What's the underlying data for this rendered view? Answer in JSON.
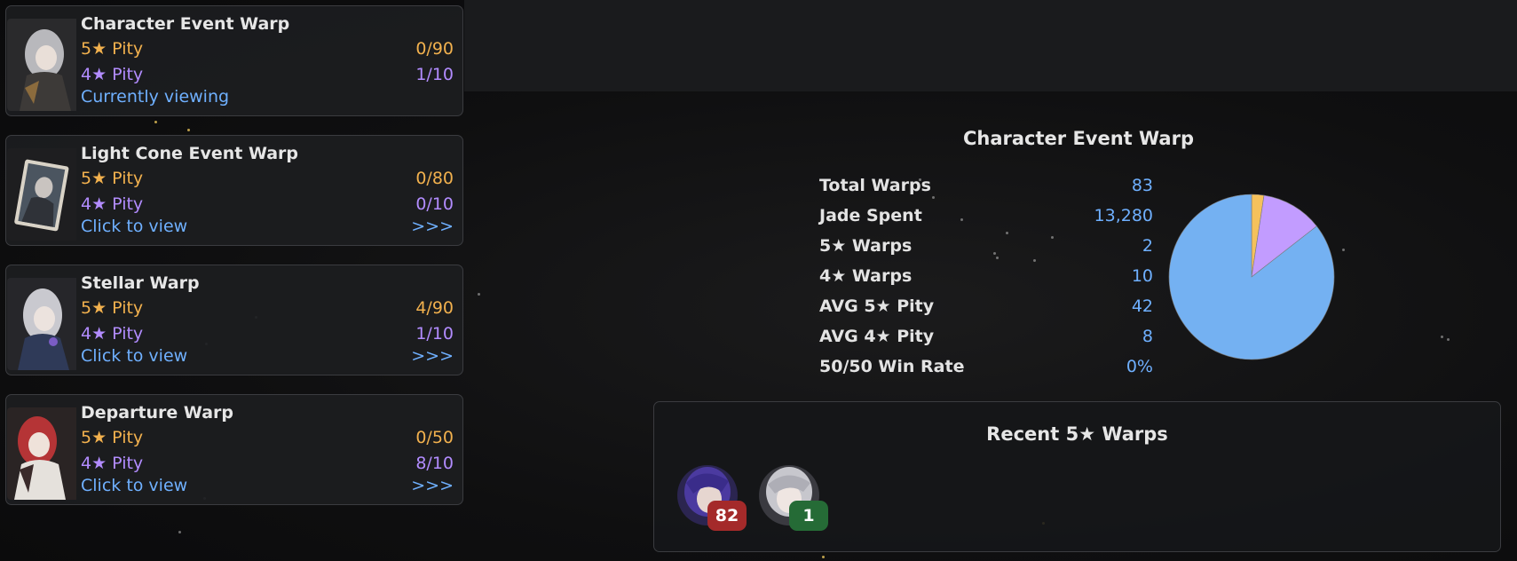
{
  "warps": [
    {
      "name": "Character Event Warp",
      "five_label": "5★ Pity",
      "five_value": "0/90",
      "four_label": "4★ Pity",
      "four_value": "1/10",
      "view_text": "Currently viewing",
      "view_arrow": ""
    },
    {
      "name": "Light Cone Event Warp",
      "five_label": "5★ Pity",
      "five_value": "0/80",
      "four_label": "4★ Pity",
      "four_value": "0/10",
      "view_text": "Click to view",
      "view_arrow": ">>>"
    },
    {
      "name": "Stellar Warp",
      "five_label": "5★ Pity",
      "five_value": "4/90",
      "four_label": "4★ Pity",
      "four_value": "1/10",
      "view_text": "Click to view",
      "view_arrow": ">>>"
    },
    {
      "name": "Departure Warp",
      "five_label": "5★ Pity",
      "five_value": "0/50",
      "four_label": "4★ Pity",
      "four_value": "8/10",
      "view_text": "Click to view",
      "view_arrow": ">>>"
    }
  ],
  "panel": {
    "title": "Character Event Warp",
    "stats": [
      {
        "label": "Total Warps",
        "value": "83"
      },
      {
        "label": "Jade Spent",
        "value": "13,280"
      },
      {
        "label": "5★ Warps",
        "value": "2"
      },
      {
        "label": "4★ Warps",
        "value": "10"
      },
      {
        "label": "AVG 5★ Pity",
        "value": "42"
      },
      {
        "label": "AVG 4★ Pity",
        "value": "8"
      },
      {
        "label": "50/50 Win Rate",
        "value": "0%"
      }
    ]
  },
  "chart_data": {
    "type": "pie",
    "slices": [
      {
        "value": 2,
        "color": "#f5c15c"
      },
      {
        "value": 10,
        "color": "#c29cff"
      },
      {
        "value": 71,
        "color": "#74b1f2"
      }
    ]
  },
  "recent": {
    "title": "Recent 5★ Warps",
    "items": [
      {
        "pity": "82",
        "badge_color": "#a42a2a"
      },
      {
        "pity": "1",
        "badge_color": "#256b36"
      }
    ]
  },
  "colors": {
    "five": "#f2b14e",
    "four": "#b28cff",
    "link": "#6fb0ff"
  }
}
